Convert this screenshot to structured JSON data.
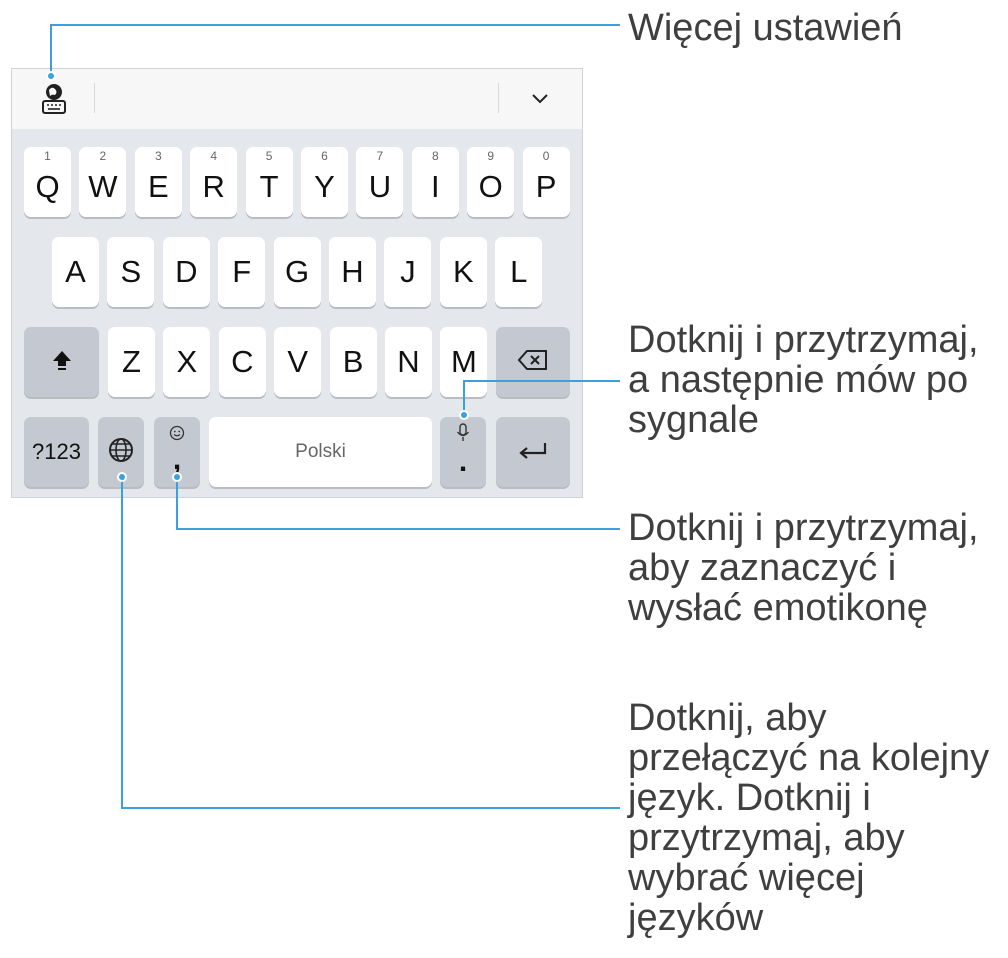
{
  "keyboard": {
    "row1": [
      {
        "letter": "Q",
        "num": "1"
      },
      {
        "letter": "W",
        "num": "2"
      },
      {
        "letter": "E",
        "num": "3"
      },
      {
        "letter": "R",
        "num": "4"
      },
      {
        "letter": "T",
        "num": "5"
      },
      {
        "letter": "Y",
        "num": "6"
      },
      {
        "letter": "U",
        "num": "7"
      },
      {
        "letter": "I",
        "num": "8"
      },
      {
        "letter": "O",
        "num": "9"
      },
      {
        "letter": "P",
        "num": "0"
      }
    ],
    "row2": [
      "A",
      "S",
      "D",
      "F",
      "G",
      "H",
      "J",
      "K",
      "L"
    ],
    "row3": [
      "Z",
      "X",
      "C",
      "V",
      "B",
      "N",
      "M"
    ],
    "sym_label": "?123",
    "comma_label": ",",
    "space_label": "Polski",
    "period_label": "."
  },
  "annotations": {
    "settings": "Więcej ustawień",
    "voice": [
      "Dotknij i przytrzymaj,",
      "a następnie mów po",
      "sygnale"
    ],
    "emoji": [
      "Dotknij i przytrzymaj,",
      "aby zaznaczyć i",
      "wysłać emotikonę"
    ],
    "language": [
      "Dotknij, aby",
      "przełączyć na kolejny",
      "język. Dotknij i",
      "przytrzymaj, aby",
      "wybrać więcej",
      "języków"
    ]
  },
  "colors": {
    "accent": "#3aa0e0",
    "keyboard_bg": "#e4e7ec",
    "key_dark": "#c4c8d0"
  },
  "icons": [
    "keyboard-settings-icon",
    "chevron-down-icon",
    "shift-icon",
    "backspace-icon",
    "globe-icon",
    "emoji-icon",
    "microphone-icon",
    "enter-icon"
  ]
}
